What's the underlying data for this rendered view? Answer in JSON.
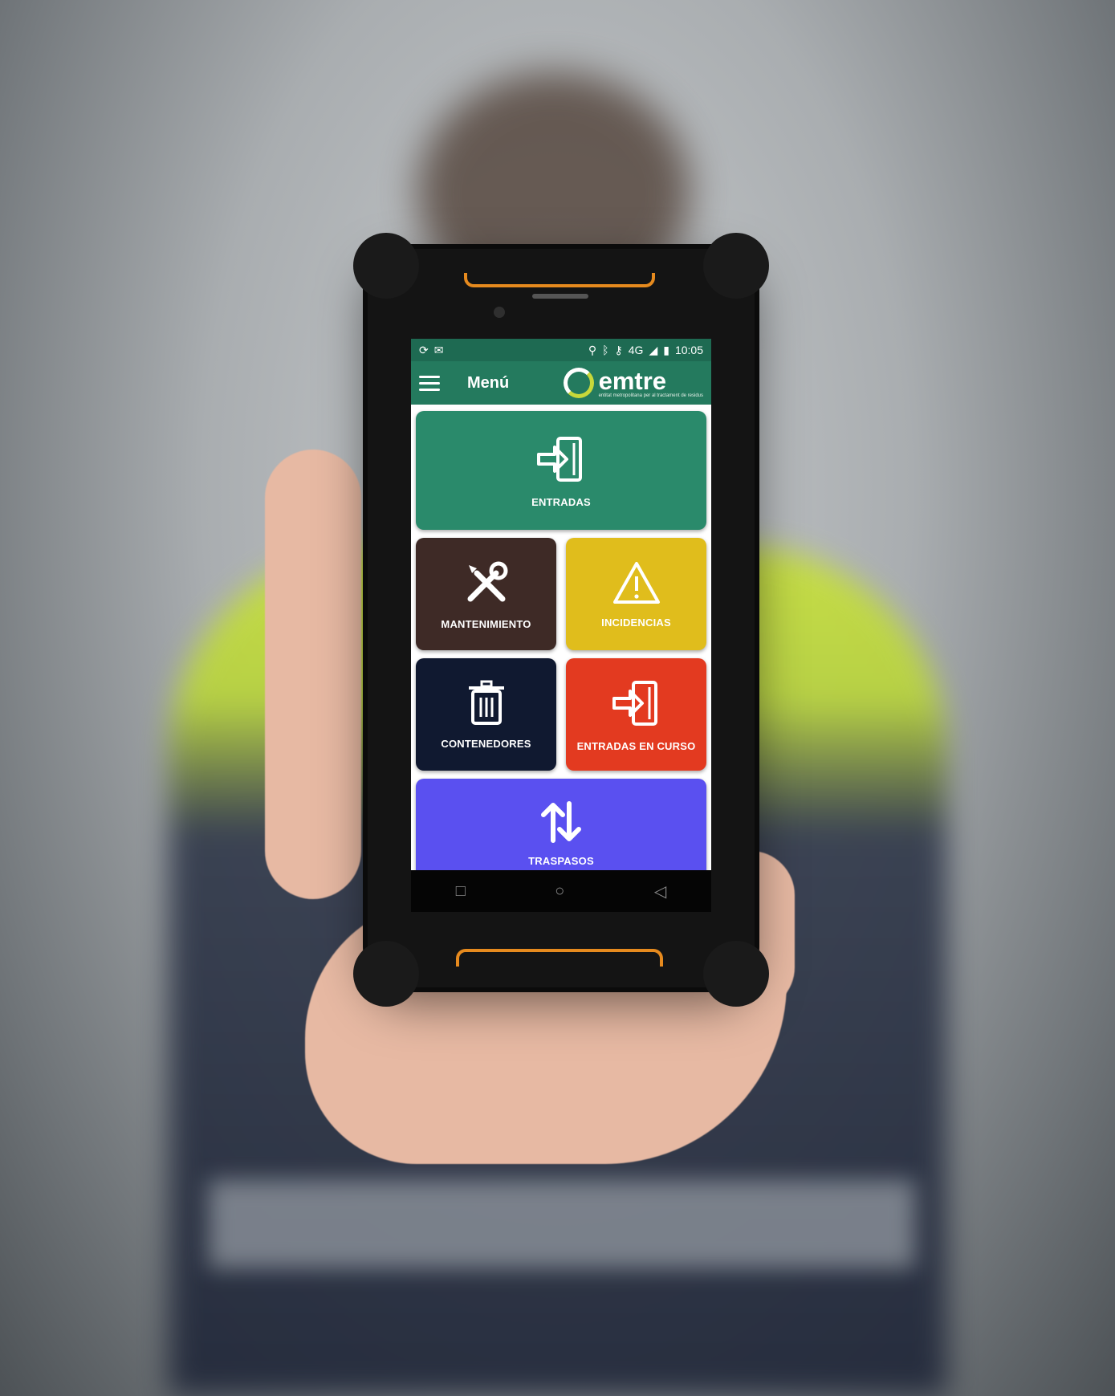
{
  "status_bar": {
    "left_icons": [
      "sync-icon",
      "mail-icon"
    ],
    "right_icons": [
      "location-icon",
      "bluetooth-icon",
      "key-icon"
    ],
    "network": "4G",
    "time": "10:05"
  },
  "app_bar": {
    "title": "Menú",
    "logo": {
      "word": "emtre",
      "tagline": "entitat metropolitana per al tractament de residus"
    }
  },
  "tiles": [
    {
      "id": "entradas",
      "label": "ENTRADAS",
      "icon": "sign-in-icon",
      "color": "#2a8a6b"
    },
    {
      "id": "mantenimiento",
      "label": "MANTENIMIENTO",
      "icon": "tools-icon",
      "color": "#3e2a26"
    },
    {
      "id": "incidencias",
      "label": "INCIDENCIAS",
      "icon": "warning-icon",
      "color": "#e0bd1c"
    },
    {
      "id": "contenedores",
      "label": "CONTENEDORES",
      "icon": "trash-icon",
      "color": "#101930"
    },
    {
      "id": "entradas_en_curso",
      "label": "ENTRADAS EN CURSO",
      "icon": "sign-in-icon",
      "color": "#e33a20"
    },
    {
      "id": "traspasos",
      "label": "TRASPASOS",
      "icon": "swap-vertical-icon",
      "color": "#5a50f0"
    }
  ],
  "nav_bar": {
    "buttons": [
      "recents-icon",
      "home-icon",
      "back-icon"
    ]
  }
}
